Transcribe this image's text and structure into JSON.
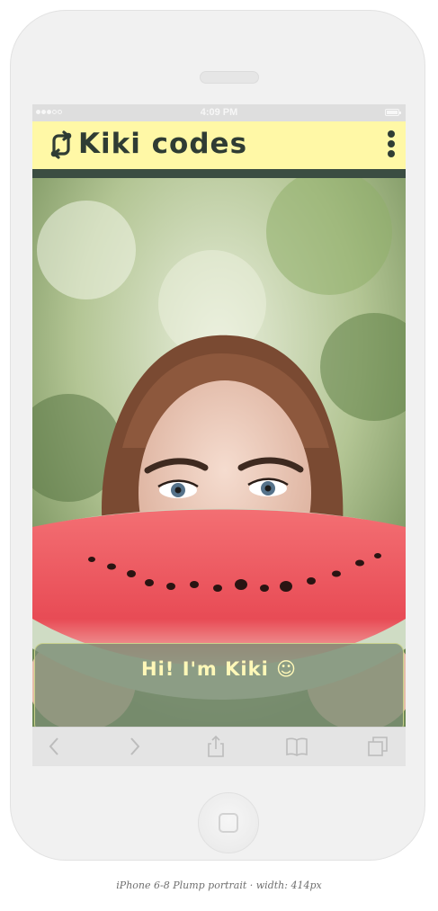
{
  "status_bar": {
    "time": "4:09 PM"
  },
  "app": {
    "title": "Kiki codes",
    "logo_icon": "sync-arrows-icon",
    "menu_icon": "vertical-dots-icon",
    "colors": {
      "header_bg": "#fff8a6",
      "header_text": "#2f3c34",
      "header_border": "#3b4d42",
      "card_text": "#fff8b8"
    }
  },
  "hero": {
    "image": "woman-holding-watermelon-photo"
  },
  "greeting": {
    "text": "Hi! I'm Kiki ☺"
  },
  "toolbar": {
    "buttons": [
      "back-icon",
      "forward-icon",
      "share-icon",
      "bookmarks-icon",
      "tabs-icon"
    ]
  },
  "caption": "iPhone 6-8 Plump portrait · width: 414px"
}
